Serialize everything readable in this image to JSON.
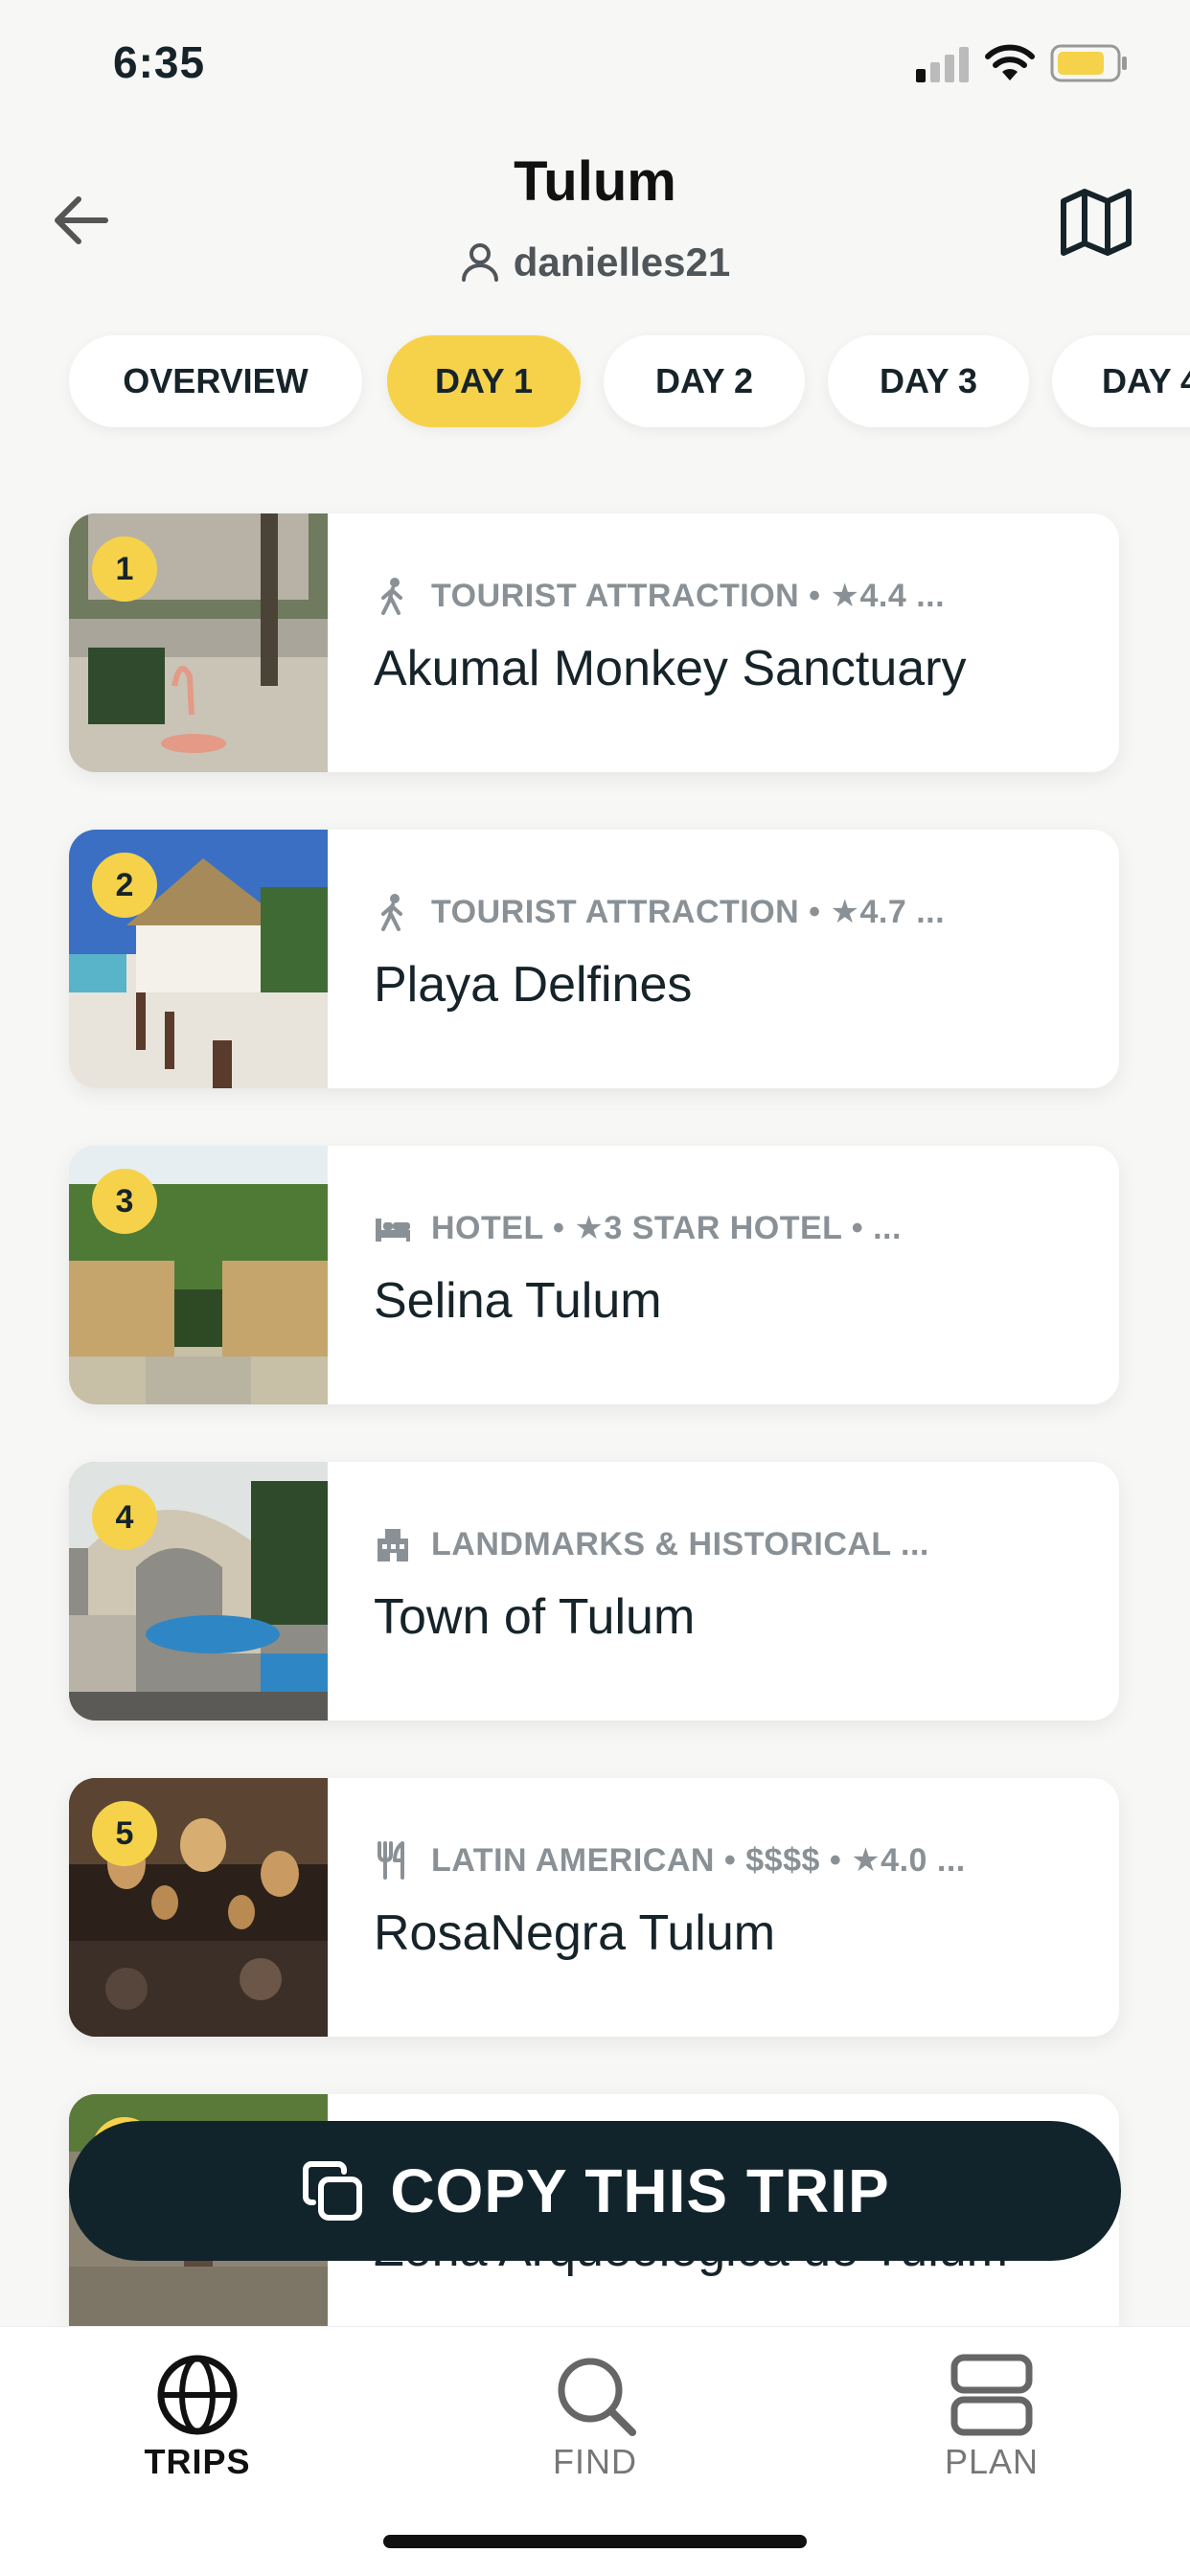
{
  "status_bar": {
    "time": "6:35"
  },
  "header": {
    "title": "Tulum",
    "username": "danielles21"
  },
  "tabs": [
    {
      "label": "OVERVIEW",
      "active": false
    },
    {
      "label": "DAY 1",
      "active": true
    },
    {
      "label": "DAY 2",
      "active": false
    },
    {
      "label": "DAY 3",
      "active": false
    },
    {
      "label": "DAY 4",
      "active": false
    }
  ],
  "places": [
    {
      "number": "1",
      "icon": "walking-icon",
      "meta": "TOURIST ATTRACTION  •  ★4.4 ...",
      "name": "Akumal Monkey Sanctuary"
    },
    {
      "number": "2",
      "icon": "walking-icon",
      "meta": "TOURIST ATTRACTION  •  ★4.7 ...",
      "name": "Playa Delfines"
    },
    {
      "number": "3",
      "icon": "bed-icon",
      "meta": "HOTEL  •  ★3 STAR HOTEL  •  ...",
      "name": "Selina Tulum"
    },
    {
      "number": "4",
      "icon": "building-icon",
      "meta": "LANDMARKS & HISTORICAL ...",
      "name": "Town of Tulum"
    },
    {
      "number": "5",
      "icon": "utensils-icon",
      "meta": "LATIN AMERICAN  •  $$$$  •  ★4.0 ...",
      "name": "RosaNegra Tulum"
    },
    {
      "number": "6",
      "icon": "",
      "meta": "",
      "name": "Zona Arqueológica de Tulum"
    }
  ],
  "copy_button": {
    "label": "COPY THIS TRIP"
  },
  "bottom_nav": [
    {
      "label": "TRIPS",
      "icon": "globe-icon",
      "active": true
    },
    {
      "label": "FIND",
      "icon": "search-icon",
      "active": false
    },
    {
      "label": "PLAN",
      "icon": "plan-icon",
      "active": false
    }
  ],
  "colors": {
    "accent": "#f6d24a",
    "dark": "#12242b",
    "muted": "#8a9196"
  }
}
